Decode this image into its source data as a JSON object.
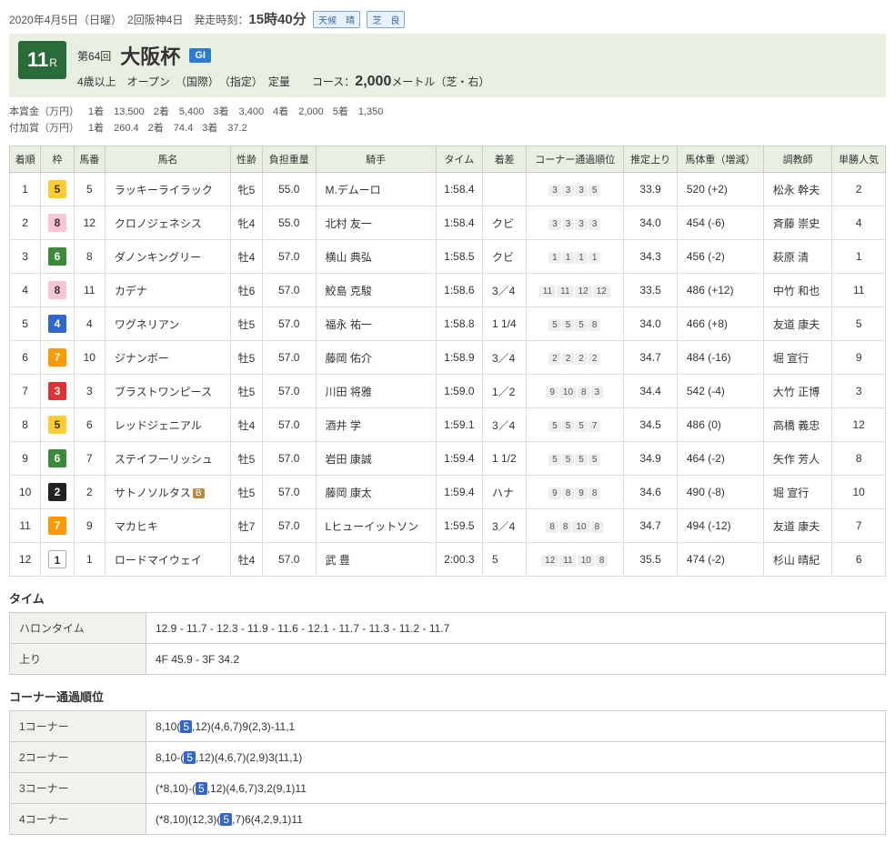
{
  "header": {
    "date_text": "2020年4月5日（日曜）　2回阪神4日　発走時刻：",
    "start_time": "15時40分",
    "weather_label": "天候",
    "weather_value": "晴",
    "track_label": "芝",
    "track_value": "良"
  },
  "race": {
    "number": "11",
    "number_suffix": "R",
    "edition": "第64回",
    "name": "大阪杯",
    "grade": "GI",
    "conditions": "4歳以上　オープン　（国際）　（指定）　定量　　コース：",
    "distance": "2,000",
    "distance_suffix": "メートル（芝・右）"
  },
  "prize": {
    "main_label": "本賞金（万円）",
    "main_items": [
      {
        "rank": "1着",
        "amt": "13,500"
      },
      {
        "rank": "2着",
        "amt": "5,400"
      },
      {
        "rank": "3着",
        "amt": "3,400"
      },
      {
        "rank": "4着",
        "amt": "2,000"
      },
      {
        "rank": "5着",
        "amt": "1,350"
      }
    ],
    "add_label": "付加賞（万円）",
    "add_items": [
      {
        "rank": "1着",
        "amt": "260.4"
      },
      {
        "rank": "2着",
        "amt": "74.4"
      },
      {
        "rank": "3着",
        "amt": "37.2"
      }
    ]
  },
  "columns": [
    "着順",
    "枠",
    "馬番",
    "馬名",
    "性齢",
    "負担重量",
    "騎手",
    "タイム",
    "着差",
    "コーナー通過順位",
    "推定上り",
    "馬体重（増減）",
    "調教師",
    "単勝人気"
  ],
  "rows": [
    {
      "rank": "1",
      "waku": "5",
      "num": "5",
      "name": "ラッキーライラック",
      "sexage": "牝5",
      "weight": "55.0",
      "jockey": "M.デムーロ",
      "time": "1:58.4",
      "margin": "",
      "corners": [
        "3",
        "3",
        "3",
        "5"
      ],
      "agari": "33.9",
      "body": "520 (+2)",
      "trainer": "松永 幹夫",
      "pop": "2"
    },
    {
      "rank": "2",
      "waku": "8",
      "num": "12",
      "name": "クロノジェネシス",
      "sexage": "牝4",
      "weight": "55.0",
      "jockey": "北村 友一",
      "time": "1:58.4",
      "margin": "クビ",
      "corners": [
        "3",
        "3",
        "3",
        "3"
      ],
      "agari": "34.0",
      "body": "454 (-6)",
      "trainer": "斉藤 崇史",
      "pop": "4"
    },
    {
      "rank": "3",
      "waku": "6",
      "num": "8",
      "name": "ダノンキングリー",
      "sexage": "牡4",
      "weight": "57.0",
      "jockey": "横山 典弘",
      "time": "1:58.5",
      "margin": "クビ",
      "corners": [
        "1",
        "1",
        "1",
        "1"
      ],
      "agari": "34.3",
      "body": "456 (-2)",
      "trainer": "萩原 清",
      "pop": "1"
    },
    {
      "rank": "4",
      "waku": "8",
      "num": "11",
      "name": "カデナ",
      "sexage": "牡6",
      "weight": "57.0",
      "jockey": "鮫島 克駿",
      "time": "1:58.6",
      "margin": "3／4",
      "corners": [
        "11",
        "11",
        "12",
        "12"
      ],
      "agari": "33.5",
      "body": "486 (+12)",
      "trainer": "中竹 和也",
      "pop": "11"
    },
    {
      "rank": "5",
      "waku": "4",
      "num": "4",
      "name": "ワグネリアン",
      "sexage": "牡5",
      "weight": "57.0",
      "jockey": "福永 祐一",
      "time": "1:58.8",
      "margin": "1 1/4",
      "corners": [
        "5",
        "5",
        "5",
        "8"
      ],
      "agari": "34.0",
      "body": "466 (+8)",
      "trainer": "友道 康夫",
      "pop": "5"
    },
    {
      "rank": "6",
      "waku": "7",
      "num": "10",
      "name": "ジナンボー",
      "sexage": "牡5",
      "weight": "57.0",
      "jockey": "藤岡 佑介",
      "time": "1:58.9",
      "margin": "3／4",
      "corners": [
        "2",
        "2",
        "2",
        "2"
      ],
      "agari": "34.7",
      "body": "484 (-16)",
      "trainer": "堀 宣行",
      "pop": "9"
    },
    {
      "rank": "7",
      "waku": "3",
      "num": "3",
      "name": "ブラストワンピース",
      "sexage": "牡5",
      "weight": "57.0",
      "jockey": "川田 将雅",
      "time": "1:59.0",
      "margin": "1／2",
      "corners": [
        "9",
        "10",
        "8",
        "3"
      ],
      "agari": "34.4",
      "body": "542 (-4)",
      "trainer": "大竹 正博",
      "pop": "3"
    },
    {
      "rank": "8",
      "waku": "5",
      "num": "6",
      "name": "レッドジェニアル",
      "sexage": "牡4",
      "weight": "57.0",
      "jockey": "酒井 学",
      "time": "1:59.1",
      "margin": "3／4",
      "corners": [
        "5",
        "5",
        "5",
        "7"
      ],
      "agari": "34.5",
      "body": "486 (0)",
      "trainer": "高橋 義忠",
      "pop": "12"
    },
    {
      "rank": "9",
      "waku": "6",
      "num": "7",
      "name": "ステイフーリッシュ",
      "sexage": "牡5",
      "weight": "57.0",
      "jockey": "岩田 康誠",
      "time": "1:59.4",
      "margin": "1 1/2",
      "corners": [
        "5",
        "5",
        "5",
        "5"
      ],
      "agari": "34.9",
      "body": "464 (-2)",
      "trainer": "矢作 芳人",
      "pop": "8"
    },
    {
      "rank": "10",
      "waku": "2",
      "num": "2",
      "name": "サトノソルタス",
      "blinker": "B",
      "sexage": "牡5",
      "weight": "57.0",
      "jockey": "藤岡 康太",
      "time": "1:59.4",
      "margin": "ハナ",
      "corners": [
        "9",
        "8",
        "9",
        "8"
      ],
      "agari": "34.6",
      "body": "490 (-8)",
      "trainer": "堀 宣行",
      "pop": "10"
    },
    {
      "rank": "11",
      "waku": "7",
      "num": "9",
      "name": "マカヒキ",
      "sexage": "牡7",
      "weight": "57.0",
      "jockey": "Lヒューイットソン",
      "time": "1:59.5",
      "margin": "3／4",
      "corners": [
        "8",
        "8",
        "10",
        "8"
      ],
      "agari": "34.7",
      "body": "494 (-12)",
      "trainer": "友道 康夫",
      "pop": "7"
    },
    {
      "rank": "12",
      "waku": "1",
      "num": "1",
      "name": "ロードマイウェイ",
      "sexage": "牡4",
      "weight": "57.0",
      "jockey": "武 豊",
      "time": "2:00.3",
      "margin": "5",
      "corners": [
        "12",
        "11",
        "10",
        "8"
      ],
      "agari": "35.5",
      "body": "474 (-2)",
      "trainer": "杉山 晴紀",
      "pop": "6"
    }
  ],
  "time_section": {
    "title": "タイム",
    "lap_label": "ハロンタイム",
    "lap_value": "12.9 - 11.7 - 12.3 - 11.9 - 11.6 - 12.1 - 11.7 - 11.3 - 11.2 - 11.7",
    "agari_label": "上り",
    "agari_value": "4F 45.9 - 3F 34.2"
  },
  "corner_section": {
    "title": "コーナー通過順位",
    "rows": [
      {
        "label": "1コーナー",
        "before": "8,10(",
        "hl": "5",
        "after": ",12)(4,6,7)9(2,3)-11,1"
      },
      {
        "label": "2コーナー",
        "before": "8,10-(",
        "hl": "5",
        "after": ",12)(4,6,7)(2,9)3(11,1)"
      },
      {
        "label": "3コーナー",
        "before": "(*8,10)-(",
        "hl": "5",
        "after": ",12)(4,6,7)3,2(9,1)11"
      },
      {
        "label": "4コーナー",
        "before": "(*8,10)(12,3)(",
        "hl": "5",
        "after": ",7)6(4,2,9,1)11"
      }
    ]
  }
}
